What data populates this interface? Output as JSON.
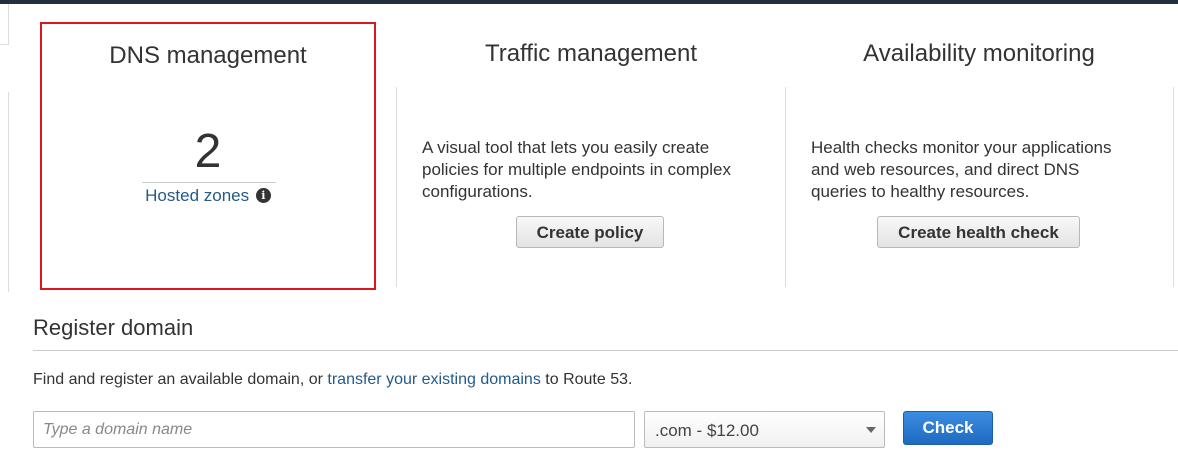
{
  "dns": {
    "title": "DNS management",
    "count": "2",
    "link_label": "Hosted zones",
    "info_glyph": "i"
  },
  "traffic": {
    "title": "Traffic management",
    "description_lines": [
      "A visual tool that lets you easily create",
      "policies for multiple endpoints in complex",
      "configurations."
    ],
    "button_label": "Create policy"
  },
  "availability": {
    "title": "Availability monitoring",
    "description_lines": [
      "Health checks monitor your applications",
      "and web resources, and direct DNS",
      "queries to healthy resources."
    ],
    "button_label": "Create health check"
  },
  "register": {
    "title": "Register domain",
    "text_before": "Find and register an available domain, or ",
    "link_text": "transfer your existing domains",
    "text_after": " to Route 53.",
    "input_placeholder": "Type a domain name",
    "input_value": "",
    "tld_selected": ".com - $12.00",
    "check_label": "Check"
  },
  "colors": {
    "highlight_border": "#d9161b",
    "link": "#245a8a",
    "primary_button": "#1f6ac2",
    "topbar": "#232f3e"
  },
  "icons": [
    "info-icon",
    "chevron-down-icon"
  ]
}
